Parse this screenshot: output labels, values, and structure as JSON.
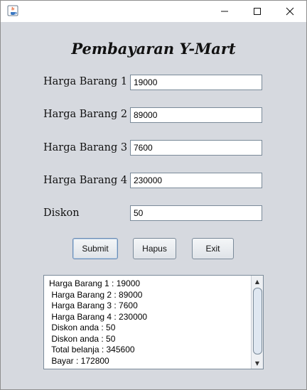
{
  "window": {
    "title": "",
    "controls": {
      "minimize": "–",
      "maximize": "☐",
      "close": "✕"
    }
  },
  "form": {
    "title": "Pembayaran Y-Mart",
    "fields": [
      {
        "label": "Harga Barang 1",
        "value": "19000"
      },
      {
        "label": "Harga Barang 2",
        "value": "89000"
      },
      {
        "label": "Harga Barang 3",
        "value": "7600"
      },
      {
        "label": "Harga Barang 4",
        "value": "230000"
      },
      {
        "label": "Diskon",
        "value": "50"
      }
    ]
  },
  "buttons": {
    "submit": "Submit",
    "clear": "Hapus",
    "exit": "Exit"
  },
  "output": {
    "lines": [
      "Harga Barang 1 : 19000",
      " Harga Barang 2 : 89000",
      " Harga Barang 3 : 7600",
      " Harga Barang 4 : 230000",
      " Diskon anda : 50",
      " Diskon anda : 50",
      " Total belanja : 345600",
      " Bayar : 172800"
    ]
  },
  "scrollbar": {
    "up": "▲",
    "down": "▼"
  },
  "icons": {
    "app": "java-app-icon"
  }
}
